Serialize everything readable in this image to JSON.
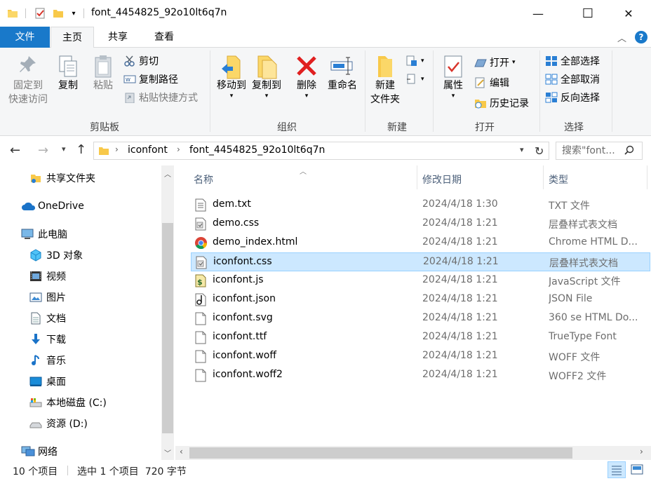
{
  "window": {
    "title": "font_4454825_92o10lt6q7n",
    "minimize_glyph": "—",
    "maximize_glyph": "☐",
    "close_glyph": "✕"
  },
  "ribbon_tabs": {
    "file": "文件",
    "home": "主页",
    "share": "共享",
    "view": "查看"
  },
  "ribbon": {
    "clipboard": {
      "pin_line1": "固定到",
      "pin_line2": "快速访问",
      "copy": "复制",
      "paste": "粘贴",
      "cut": "剪切",
      "copy_path": "复制路径",
      "paste_shortcut": "粘贴快捷方式",
      "label": "剪贴板"
    },
    "organize": {
      "move_to": "移动到",
      "copy_to": "复制到",
      "delete": "删除",
      "rename": "重命名",
      "label": "组织"
    },
    "new": {
      "new_folder_line1": "新建",
      "new_folder_line2": "文件夹",
      "label": "新建"
    },
    "open": {
      "properties": "属性",
      "open": "打开",
      "edit": "编辑",
      "history": "历史记录",
      "label": "打开"
    },
    "select": {
      "select_all": "全部选择",
      "select_none": "全部取消",
      "invert": "反向选择",
      "label": "选择"
    }
  },
  "address": {
    "crumbs": [
      "iconfont",
      "font_4454825_92o10lt6q7n"
    ],
    "search_placeholder": "搜索\"font..."
  },
  "nav": {
    "items": [
      {
        "label": "共享文件夹",
        "icon": "folder-share-icon"
      },
      {
        "label": "OneDrive",
        "icon": "cloud-icon"
      },
      {
        "label": "此电脑",
        "icon": "computer-icon"
      },
      {
        "label": "3D 对象",
        "icon": "cube-icon"
      },
      {
        "label": "视频",
        "icon": "video-icon"
      },
      {
        "label": "图片",
        "icon": "picture-icon"
      },
      {
        "label": "文档",
        "icon": "document-icon"
      },
      {
        "label": "下载",
        "icon": "download-icon"
      },
      {
        "label": "音乐",
        "icon": "music-icon"
      },
      {
        "label": "桌面",
        "icon": "desktop-icon"
      },
      {
        "label": "本地磁盘 (C:)",
        "icon": "drive-c-icon"
      },
      {
        "label": "资源 (D:)",
        "icon": "drive-d-icon"
      },
      {
        "label": "网络",
        "icon": "network-icon"
      }
    ]
  },
  "columns": {
    "name": "名称",
    "date": "修改日期",
    "type": "类型"
  },
  "files": [
    {
      "name": "dem.txt",
      "date": "2024/4/18 1:30",
      "type": "TXT 文件",
      "icon": "text-file-icon",
      "selected": false
    },
    {
      "name": "demo.css",
      "date": "2024/4/18 1:21",
      "type": "层叠样式表文档",
      "icon": "css-file-icon",
      "selected": false
    },
    {
      "name": "demo_index.html",
      "date": "2024/4/18 1:21",
      "type": "Chrome HTML D...",
      "icon": "chrome-icon",
      "selected": false
    },
    {
      "name": "iconfont.css",
      "date": "2024/4/18 1:21",
      "type": "层叠样式表文档",
      "icon": "css-file-icon",
      "selected": true
    },
    {
      "name": "iconfont.js",
      "date": "2024/4/18 1:21",
      "type": "JavaScript 文件",
      "icon": "js-file-icon",
      "selected": false
    },
    {
      "name": "iconfont.json",
      "date": "2024/4/18 1:21",
      "type": "JSON File",
      "icon": "json-file-icon",
      "selected": false
    },
    {
      "name": "iconfont.svg",
      "date": "2024/4/18 1:21",
      "type": "360 se HTML Do...",
      "icon": "blank-file-icon",
      "selected": false
    },
    {
      "name": "iconfont.ttf",
      "date": "2024/4/18 1:21",
      "type": "TrueType Font",
      "icon": "blank-file-icon",
      "selected": false
    },
    {
      "name": "iconfont.woff",
      "date": "2024/4/18 1:21",
      "type": "WOFF 文件",
      "icon": "blank-file-icon",
      "selected": false
    },
    {
      "name": "iconfont.woff2",
      "date": "2024/4/18 1:21",
      "type": "WOFF2 文件",
      "icon": "blank-file-icon",
      "selected": false
    }
  ],
  "status": {
    "count": "10 个项目",
    "selection": "选中 1 个项目  720 字节"
  },
  "colors": {
    "accent": "#1979ca",
    "selection": "#cce8ff",
    "selection_border": "#99d1ff",
    "folder": "#f8c94a"
  }
}
